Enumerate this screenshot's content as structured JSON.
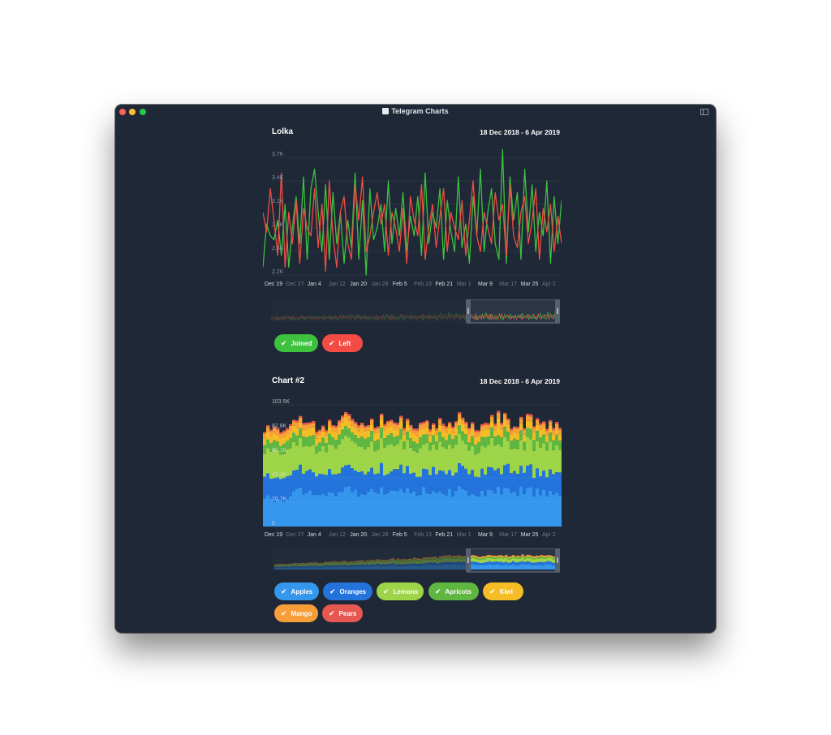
{
  "window": {
    "title": "Telegram Charts"
  },
  "chart1": {
    "title": "Lolka",
    "range": "18 Dec 2018 - 6 Apr 2019",
    "chips": [
      {
        "label": "Joined",
        "color": "#3cc23f"
      },
      {
        "label": "Left",
        "color": "#f34c44"
      }
    ]
  },
  "chart2": {
    "title": "Chart #2",
    "range": "18 Dec 2018 - 6 Apr 2019",
    "chips": [
      {
        "label": "Apples",
        "color": "#3497ed"
      },
      {
        "label": "Oranges",
        "color": "#2373db"
      },
      {
        "label": "Lemons",
        "color": "#9ed448"
      },
      {
        "label": "Apricots",
        "color": "#5fb641"
      },
      {
        "label": "Kiwi",
        "color": "#f5bd25"
      },
      {
        "label": "Mango",
        "color": "#f79e39"
      },
      {
        "label": "Pears",
        "color": "#e65850"
      }
    ]
  },
  "chart_data": [
    {
      "type": "line",
      "title": "Lolka",
      "subtitle": "18 Dec 2018 - 6 Apr 2019",
      "x": [
        "Dec 19",
        "Dec 27",
        "Jan 4",
        "Jan 12",
        "Jan 20",
        "Jan 28",
        "Feb 5",
        "Feb 13",
        "Feb 21",
        "Mar 1",
        "Mar 9",
        "Mar 17",
        "Mar 25",
        "Apr 2"
      ],
      "x_tick_emphasis": [
        true,
        false,
        true,
        false,
        true,
        false,
        true,
        false,
        true,
        false,
        true,
        false,
        true,
        false
      ],
      "y_ticks": [
        "3.7K",
        "3.4K",
        "3.1K",
        "2.8K",
        "2.5K",
        "2.2K"
      ],
      "ylim": [
        2200,
        3700
      ],
      "grid": true,
      "series": [
        {
          "name": "Joined",
          "color": "#3cc23f",
          "values": [
            2300,
            2850,
            2700,
            2650,
            2900,
            2450,
            3100,
            2300,
            2800,
            3200,
            2600,
            3450,
            2400,
            3300,
            3550,
            3000,
            2500,
            3350,
            2400,
            3250,
            2600,
            3000,
            2350,
            2900,
            2550,
            3500,
            2400,
            3150,
            2200,
            3300,
            2650,
            2800,
            3100,
            2500,
            3400,
            2600,
            3050,
            2700,
            3250,
            2500,
            2950,
            2700,
            3200,
            2450,
            3500,
            2600,
            3000,
            2800,
            3300,
            2400,
            3150,
            2750,
            2500,
            3450,
            2550,
            2850,
            2350,
            3200,
            2700,
            3550,
            2500,
            3000,
            3300,
            2600,
            2400,
            3800,
            2350,
            3450,
            2900,
            3250,
            2400,
            3550,
            2750,
            3350,
            2500,
            3000,
            2700,
            3400,
            2350,
            3200,
            2600,
            3150
          ]
        },
        {
          "name": "Left",
          "color": "#f34c44",
          "values": [
            3000,
            2750,
            3300,
            2900,
            2450,
            3500,
            2300,
            3000,
            2600,
            3150,
            2350,
            3050,
            2800,
            2700,
            3300,
            2550,
            3100,
            2250,
            3400,
            2700,
            2300,
            3000,
            3200,
            2600,
            2400,
            3350,
            2900,
            3450,
            2500,
            2700,
            3000,
            3250,
            2850,
            3100,
            2450,
            3000,
            2800,
            2500,
            3050,
            2350,
            3200,
            2900,
            2700,
            3350,
            2400,
            2800,
            3100,
            2550,
            2950,
            3300,
            2500,
            3000,
            2800,
            2650,
            3150,
            2450,
            2900,
            3400,
            2700,
            2500,
            3000,
            2800,
            2600,
            3250,
            2900,
            3100,
            2450,
            3350,
            2700,
            2550,
            3000,
            3200,
            2600,
            2900,
            3300,
            2400,
            3050,
            2750,
            3100,
            2500,
            2950,
            2600
          ]
        }
      ]
    },
    {
      "type": "area",
      "title": "Chart #2",
      "subtitle": "18 Dec 2018 - 6 Apr 2019",
      "x": [
        "Dec 19",
        "Dec 27",
        "Jan 4",
        "Jan 12",
        "Jan 20",
        "Jan 28",
        "Feb 5",
        "Feb 13",
        "Feb 21",
        "Mar 1",
        "Mar 9",
        "Mar 17",
        "Mar 25",
        "Apr 2"
      ],
      "x_tick_emphasis": [
        true,
        false,
        true,
        false,
        true,
        false,
        true,
        false,
        true,
        false,
        true,
        false,
        true,
        false
      ],
      "y_ticks": [
        "103.5K",
        "82.8K",
        "62.1K",
        "41.4K",
        "20.7K",
        "0"
      ],
      "ylim": [
        0,
        103500
      ],
      "stacked": true,
      "grid": true,
      "series": [
        {
          "name": "Apples",
          "color": "#3497ed",
          "approx_value": 30000
        },
        {
          "name": "Oranges",
          "color": "#2373db",
          "approx_value": 18000
        },
        {
          "name": "Lemons",
          "color": "#9ed448",
          "approx_value": 22000
        },
        {
          "name": "Apricots",
          "color": "#5fb641",
          "approx_value": 8000
        },
        {
          "name": "Kiwi",
          "color": "#f5bd25",
          "approx_value": 6000
        },
        {
          "name": "Mango",
          "color": "#f79e39",
          "approx_value": 4000
        },
        {
          "name": "Pears",
          "color": "#e65850",
          "approx_value": 1500
        }
      ]
    }
  ]
}
